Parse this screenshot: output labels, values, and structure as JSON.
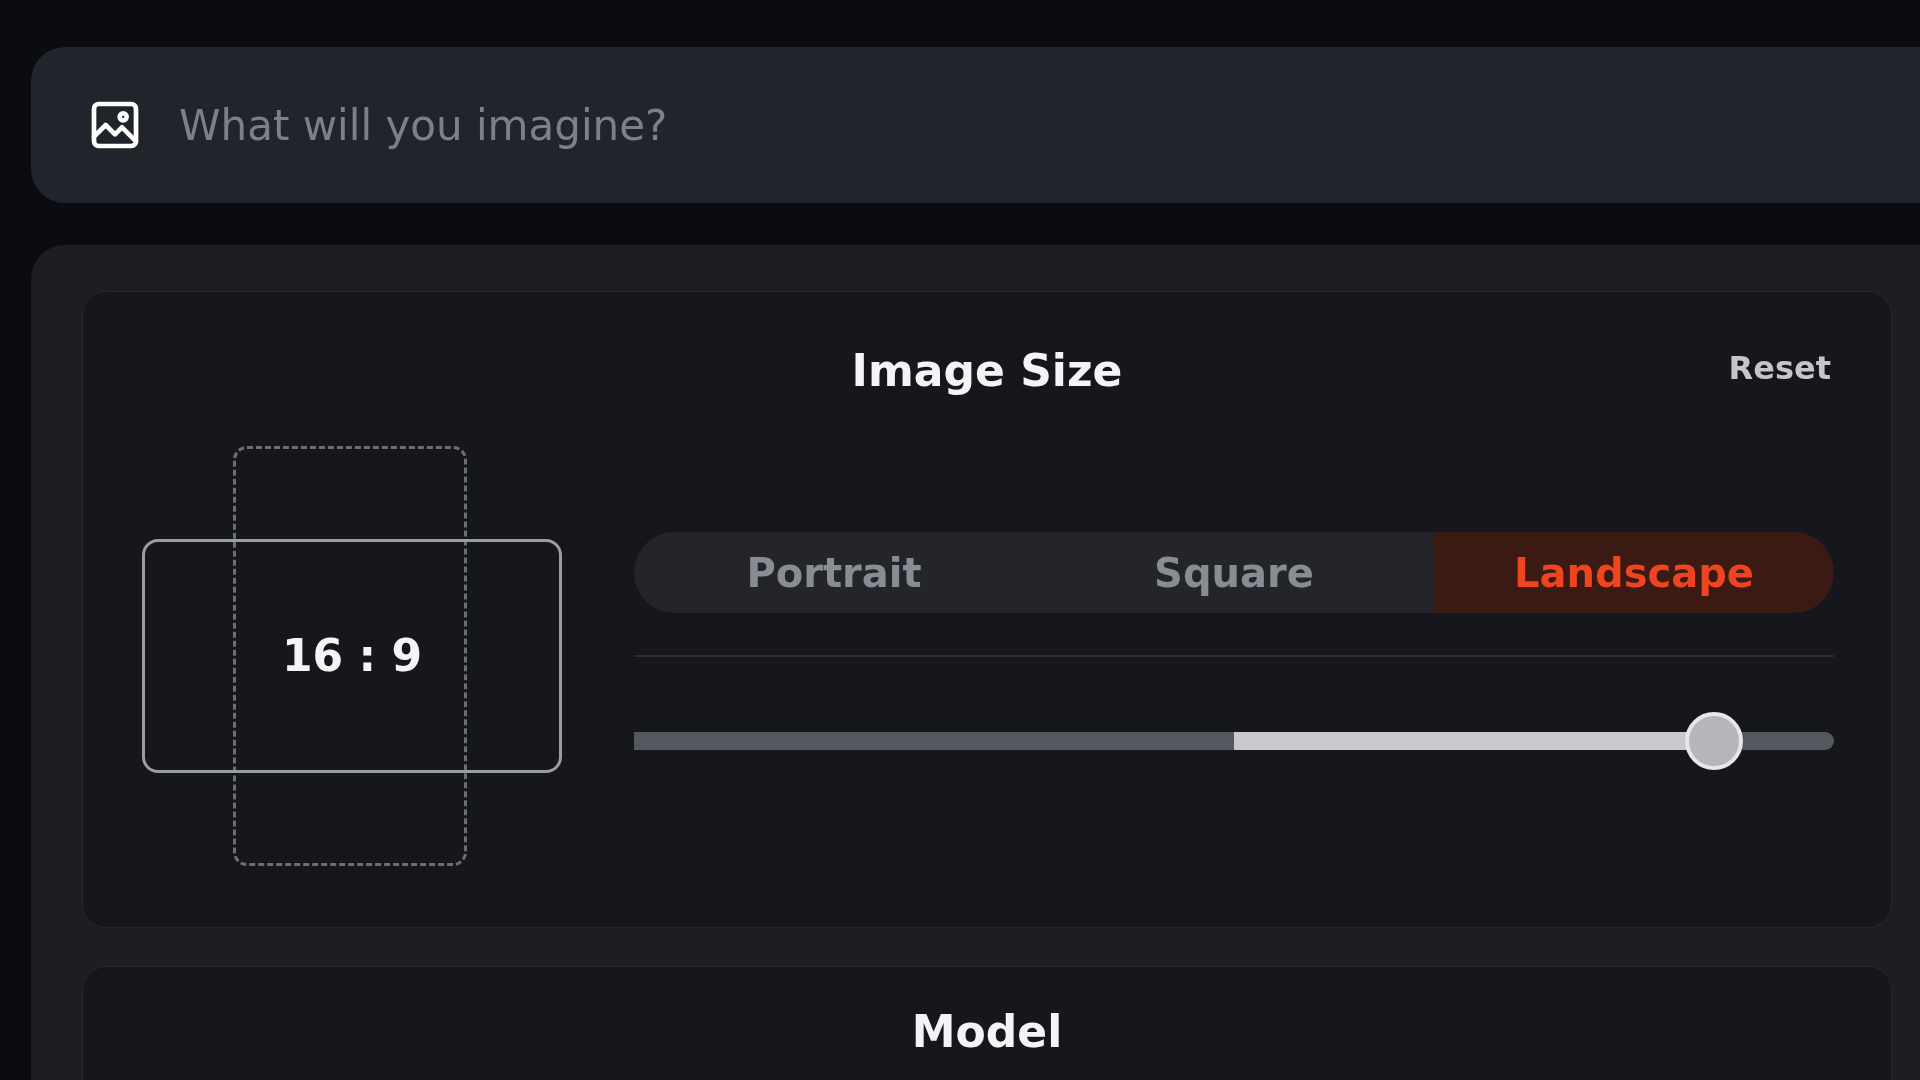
{
  "prompt": {
    "placeholder": "What will you imagine?"
  },
  "image_size": {
    "title": "Image Size",
    "reset": "Reset",
    "ratio": "16 : 9",
    "orientations": [
      {
        "label": "Portrait",
        "selected": false
      },
      {
        "label": "Square",
        "selected": false
      },
      {
        "label": "Landscape",
        "selected": true
      }
    ],
    "slider": {
      "level": 0.9
    }
  },
  "model": {
    "title": "Model"
  }
}
